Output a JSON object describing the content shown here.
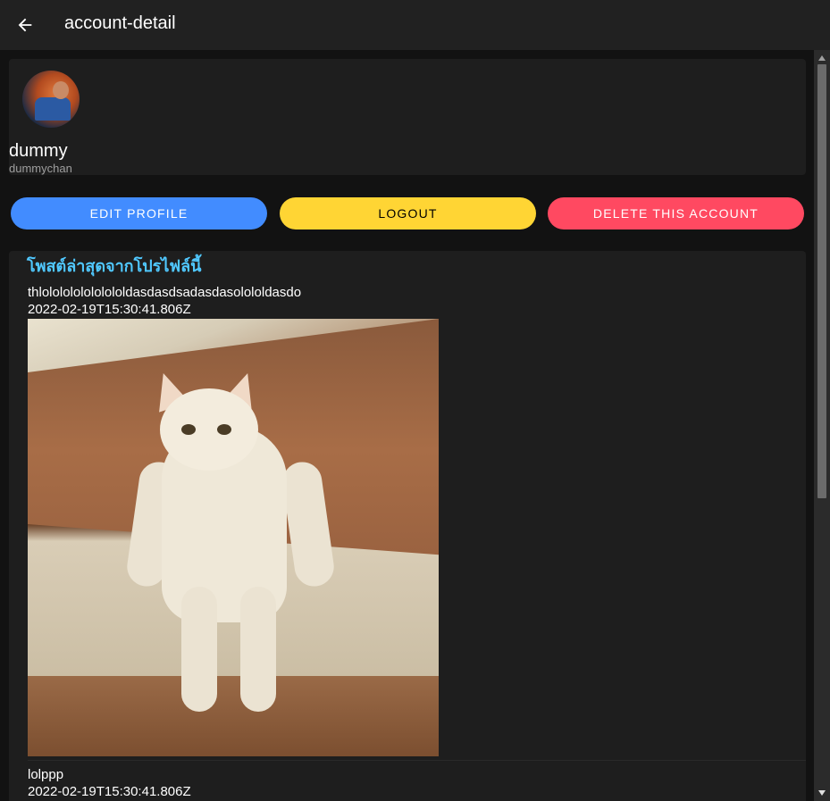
{
  "toolbar": {
    "title": "account-detail",
    "back_icon": "arrow-left-icon"
  },
  "profile": {
    "name": "dummy",
    "username": "dummychan",
    "avatar_icon": "avatar-image"
  },
  "actions": {
    "edit_label": "EDIT PROFILE",
    "logout_label": "LOGOUT",
    "delete_label": "DELETE THIS ACCOUNT"
  },
  "posts": {
    "header": "โพสต์ล่าสุดจากโปรไฟล์นี้",
    "items": [
      {
        "text": "thlololololololololdasdasdsadasdasolololdasdo",
        "date": "2022-02-19T15:30:41.806Z",
        "image_icon": "cat-photo"
      },
      {
        "text": "lolppp",
        "date": "2022-02-19T15:30:41.806Z"
      }
    ]
  },
  "colors": {
    "primary": "#428cff",
    "warning": "#ffd534",
    "danger": "#ff4961",
    "header_accent": "#50c8ff",
    "background": "#121212",
    "card": "#1e1e1e",
    "toolbar": "#212121"
  }
}
